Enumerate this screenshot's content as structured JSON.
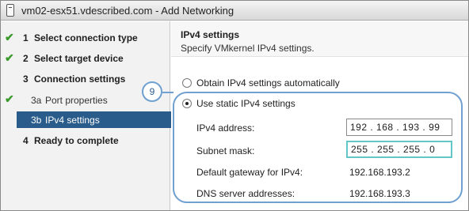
{
  "window": {
    "title": "vm02-esx51.vdescribed.com - Add Networking"
  },
  "steps": [
    {
      "number": "1",
      "label": "Select connection type",
      "completed": true
    },
    {
      "number": "2",
      "label": "Select target device",
      "completed": true
    },
    {
      "number": "3",
      "label": "Connection settings",
      "completed": false
    },
    {
      "number": "3a",
      "label": "Port properties",
      "completed": true
    },
    {
      "number": "3b",
      "label": "IPv4 settings",
      "completed": false,
      "active": true
    },
    {
      "number": "4",
      "label": "Ready to complete",
      "completed": false
    }
  ],
  "main": {
    "title": "IPv4 settings",
    "subtitle": "Specify VMkernel IPv4 settings.",
    "option_auto": "Obtain IPv4 settings automatically",
    "option_static": "Use static IPv4 settings",
    "selected_option": "static",
    "callout_number": "9",
    "fields": {
      "ipv4_address_label": "IPv4 address:",
      "ipv4_address_value": "192 . 168 . 193 . 99",
      "subnet_mask_label": "Subnet mask:",
      "subnet_mask_value": "255 . 255 . 255 . 0",
      "gateway_label": "Default gateway for IPv4:",
      "gateway_value": "192.168.193.2",
      "dns_label": "DNS server addresses:",
      "dns_value": "192.168.193.3"
    }
  },
  "colors": {
    "accent": "#295c8a",
    "check": "#3a9a2b",
    "highlight": "#6fa0cf",
    "focus": "#63c7c7"
  }
}
